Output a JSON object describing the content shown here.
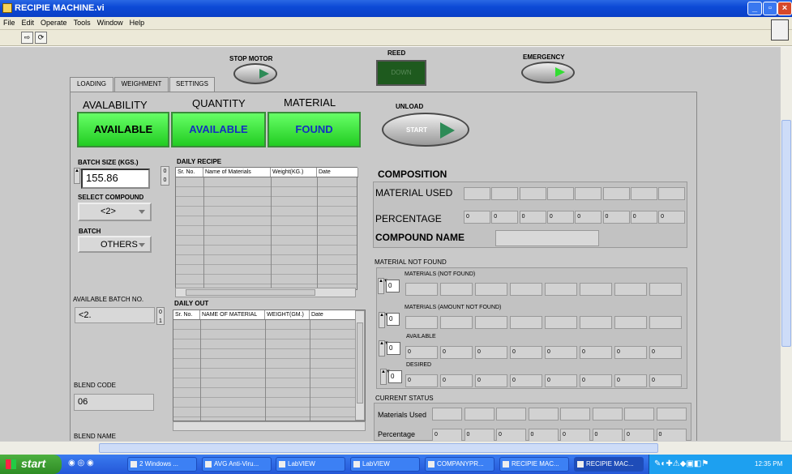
{
  "window": {
    "title": "RECIPIE MACHINE.vi"
  },
  "menu": [
    "File",
    "Edit",
    "Operate",
    "Tools",
    "Window",
    "Help"
  ],
  "top_controls": {
    "stop_motor": "STOP MOTOR",
    "reed": "REED",
    "reed_value": "DOWN",
    "emergency": "EMERGENCY"
  },
  "tabs": [
    "LOADING",
    "WEIGHMENT",
    "SETTINGS"
  ],
  "status_headers": {
    "availability": "AVALABILITY",
    "quantity": "QUANTITY",
    "material": "MATERIAL"
  },
  "status_values": {
    "availability": "AVAILABLE",
    "quantity": "AVAILABLE",
    "material": "FOUND"
  },
  "unload": {
    "label": "UNLOAD",
    "button": "START"
  },
  "batch": {
    "size_label": "BATCH SIZE (KGS.)",
    "size_value": "155.86",
    "index_values": [
      "0",
      "0"
    ],
    "select_compound_label": "SELECT COMPOUND",
    "select_compound_value": "<2>",
    "batch_label": "BATCH",
    "batch_value": "OTHERS",
    "available_batch_label": "AVAILABLE BATCH NO.",
    "available_batch_value": "<2.",
    "available_batch_index": [
      "0",
      "1"
    ],
    "blend_code_label": "BLEND CODE",
    "blend_code_value": "06",
    "blend_name_label": "BLEND NAME"
  },
  "daily_recipe": {
    "title": "DAILY RECIPE",
    "columns": [
      "Sr. No.",
      "Name of Materials",
      "Weight(KG.)",
      "Date"
    ]
  },
  "daily_out": {
    "title": "DAILY OUT",
    "columns": [
      "Sr. No.",
      "NAME OF MATERIAL",
      "WEIGHT(GM.)",
      "Date"
    ]
  },
  "composition": {
    "title": "COMPOSITION",
    "material_used": "MATERIAL USED",
    "percentage": "PERCENTAGE",
    "percentage_values": [
      "0",
      "0",
      "0",
      "0",
      "0",
      "0",
      "0",
      "0"
    ],
    "compound_name": "COMPOUND NAME"
  },
  "material_not_found": {
    "title": "MATERIAL NOT FOUND",
    "materials_label": "MATERIALS (NOT FOUND)",
    "amount_label": "MATERIALS (AMOUNT NOT FOUND)",
    "available_label": "AVAILABLE",
    "desired_label": "DESIRED",
    "index_values": [
      "0",
      "0",
      "0",
      "0"
    ],
    "available_values": [
      "0",
      "0",
      "0",
      "0",
      "0",
      "0",
      "0",
      "0"
    ],
    "desired_values": [
      "0",
      "0",
      "0",
      "0",
      "0",
      "0",
      "0",
      "0"
    ]
  },
  "current_status": {
    "title": "CURRENT STATUS",
    "materials_used": "Materials Used",
    "percentage": "Percentage",
    "percentage_values": [
      "0",
      "0",
      "0",
      "0",
      "0",
      "0",
      "0",
      "0"
    ]
  },
  "taskbar": {
    "start": "start",
    "tasks": [
      "2 Windows ...",
      "AVG Anti-Viru...",
      "LabVIEW",
      "LabVIEW",
      "COMPANYPR...",
      "RECIPIE MAC...",
      "RECIPIE MAC..."
    ],
    "clock": "12:35 PM"
  },
  "colors": {
    "indicator_green": "#33ee33",
    "panel": "#c9c9c9",
    "titlebar": "#0d4ad6"
  }
}
